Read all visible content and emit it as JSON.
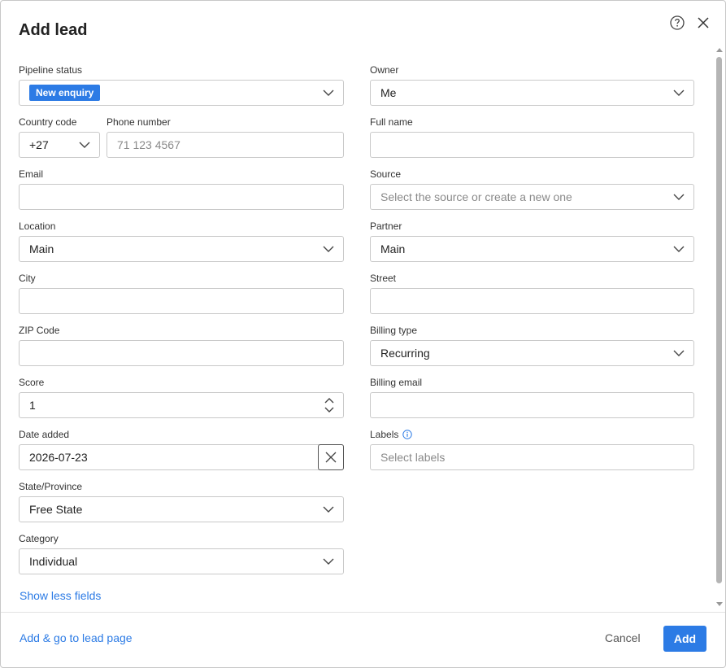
{
  "dialog": {
    "title": "Add lead",
    "help_icon": "question-circle-icon",
    "close_icon": "close-icon"
  },
  "fields": {
    "pipeline_status": {
      "label": "Pipeline status",
      "value": "New enquiry"
    },
    "owner": {
      "label": "Owner",
      "value": "Me"
    },
    "country_code": {
      "label": "Country code",
      "value": "+27"
    },
    "phone_number": {
      "label": "Phone number",
      "placeholder": "71 123 4567",
      "value": ""
    },
    "full_name": {
      "label": "Full name",
      "value": ""
    },
    "email": {
      "label": "Email",
      "value": ""
    },
    "source": {
      "label": "Source",
      "placeholder": "Select the source or create a new one"
    },
    "location": {
      "label": "Location",
      "value": "Main"
    },
    "partner": {
      "label": "Partner",
      "value": "Main"
    },
    "city": {
      "label": "City",
      "value": ""
    },
    "street": {
      "label": "Street",
      "value": ""
    },
    "zip_code": {
      "label": "ZIP Code",
      "value": ""
    },
    "billing_type": {
      "label": "Billing type",
      "value": "Recurring"
    },
    "score": {
      "label": "Score",
      "value": "1"
    },
    "billing_email": {
      "label": "Billing email",
      "value": ""
    },
    "date_added": {
      "label": "Date added",
      "value": "2026-07-23"
    },
    "labels": {
      "label": "Labels",
      "placeholder": "Select labels"
    },
    "state_province": {
      "label": "State/Province",
      "value": "Free State"
    },
    "category": {
      "label": "Category",
      "value": "Individual"
    }
  },
  "links": {
    "show_less": "Show less fields",
    "add_go": "Add & go to lead page"
  },
  "buttons": {
    "cancel": "Cancel",
    "add": "Add"
  },
  "colors": {
    "accent": "#2c7be5",
    "border": "#c9c9c9"
  }
}
